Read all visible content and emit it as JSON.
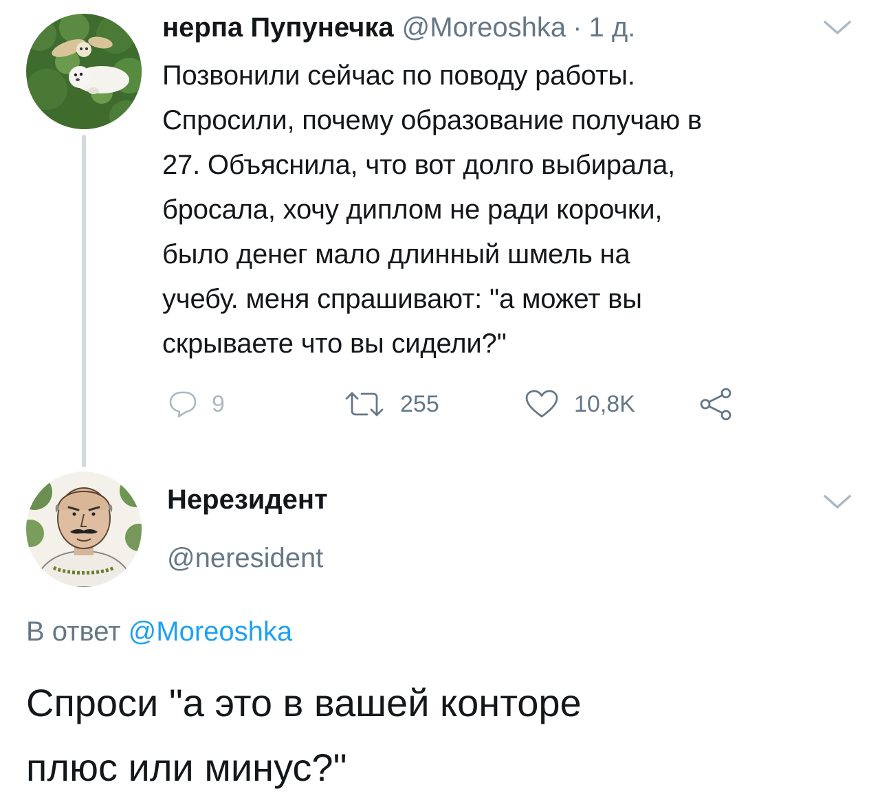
{
  "tweet1": {
    "display_name": "нерпа Пупунечка",
    "handle": "@Moreoshka",
    "separator": "·",
    "time": "1 д.",
    "text": "Позвонили сейчас по поводу работы.\nСпросили, почему образование получаю в\n27. Объяснила, что вот долго выбирала,\nбросала, хочу диплом не ради корочки,\nбыло денег мало длинный шмель на\nучебу. меня спрашивают: \"а может вы\nскрываете что вы сидели?\"",
    "actions": {
      "replies": "9",
      "retweets": "255",
      "likes": "10,8K"
    }
  },
  "tweet2": {
    "display_name": "Нерезидент",
    "handle": "@neresident",
    "reply_prefix": "В ответ ",
    "reply_mention": "@Moreoshka",
    "text": "Спроси \"а это в вашей конторе\nплюс или минус?\""
  },
  "icons": {
    "reply": "reply-icon",
    "retweet": "retweet-icon",
    "like": "heart-icon",
    "share": "share-icon",
    "menu": "chevron-down-icon"
  },
  "colors": {
    "text": "#14171a",
    "muted": "#657786",
    "link": "#1da1f2",
    "thread_line": "#cfd9de"
  }
}
